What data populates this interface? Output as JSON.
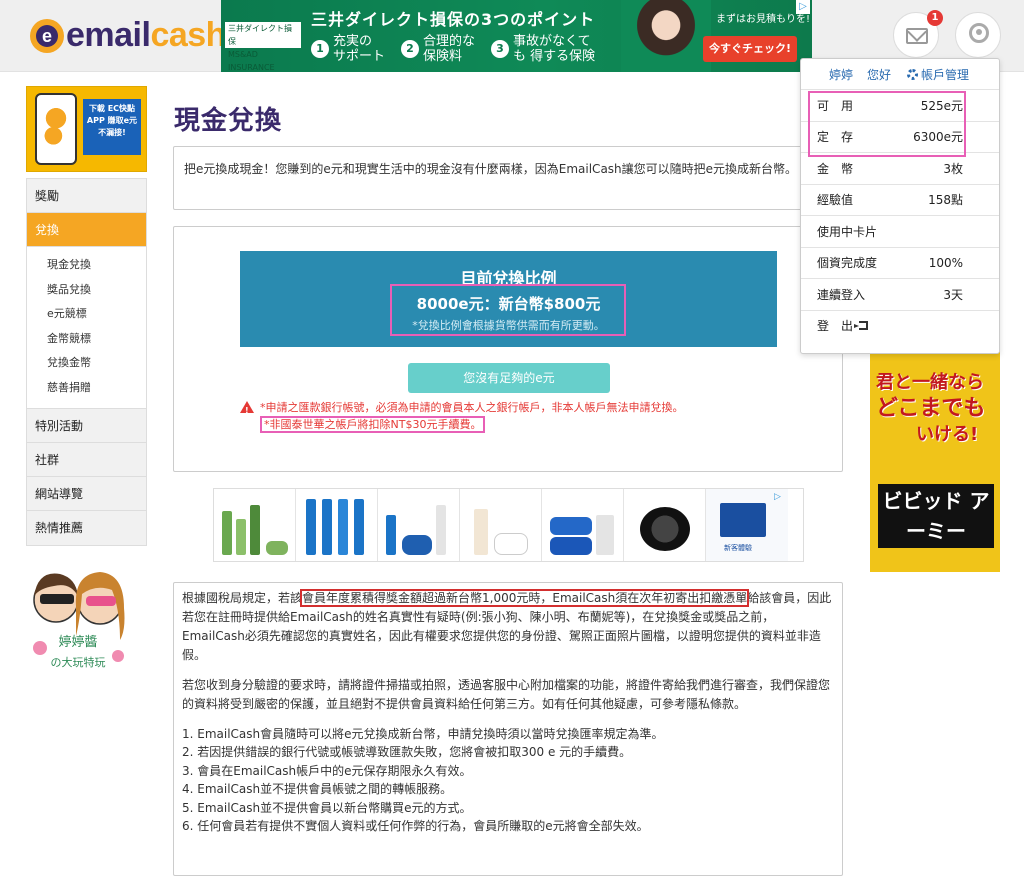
{
  "header": {
    "logo_e": "e",
    "logo_text_a": "email",
    "logo_text_b": "cash",
    "mail_badge": "1"
  },
  "top_ad": {
    "brand": "三井ダイレクト損保",
    "brand_sub": "MS&AD INSURANCE GROUP",
    "headline": "三井ダイレクト損保の3つのポイント",
    "points": [
      {
        "num": "1",
        "text": "充実の サポート"
      },
      {
        "num": "2",
        "text": "合理的な 保険料"
      },
      {
        "num": "3",
        "text": "事故がなくても 得する保険"
      }
    ],
    "small": "まずはお見積もりを!",
    "cta": "今すぐチェック!"
  },
  "sidebar": {
    "app_ad": "下載 EC快點APP 賺取e元 不漏接!",
    "items": [
      {
        "label": "獎勵"
      },
      {
        "label": "兌換"
      }
    ],
    "sub_items": [
      "現金兌換",
      "獎品兌換",
      "e元競標",
      "金幣競標",
      "兌換金幣",
      "慈善捐贈"
    ],
    "items_after": [
      {
        "label": "特別活動"
      },
      {
        "label": "社群"
      },
      {
        "label": "網站導覽"
      },
      {
        "label": "熱情推薦"
      }
    ],
    "mascot_text": "婷婷醬の大玩特玩"
  },
  "main": {
    "title": "現金兌換",
    "intro": "把e元換成現金！您賺到的e元和現實生活中的現金沒有什麼兩樣，因為EmailCash讓您可以隨時把e元換成新台幣。",
    "rate_title": "目前兌換比例",
    "rate_value": "8000e元：新台幣$800元",
    "rate_note": "*兌換比例會根據貨幣供需而有所更動。",
    "button": "您沒有足夠的e元",
    "warn_1": "*申請之匯款銀行帳號，必須為申請的會員本人之銀行帳戶，非本人帳戶無法申請兌換。",
    "warn_2": "*非國泰世華之帳戶將扣除NT$30元手續費。"
  },
  "rules": {
    "p1_a": "根據國稅局規定，若該",
    "p1_hl": "會員年度累積得獎金額超過新台幣1,000元時，EmailCash須在次年初寄出扣繳憑單",
    "p1_b": "給該會員，因此若您在註冊時提供給EmailCash的姓名真實性有疑時(例:張小狗、陳小明、布蘭妮等)，在兌換獎金或獎品之前，EmailCash必須先確認您的真實姓名，因此有權要求您提供您的身份證、駕照正面照片圖檔，以證明您提供的資料並非造假。",
    "p2": "若您收到身分驗證的要求時，請將證件掃描或拍照，透過客服中心附加檔案的功能，將證件寄給我們進行審查，我們保證您的資料將受到嚴密的保護，並且絕對不提供會員資料給任何第三方。如有任何其他疑慮，可參考隱私條款。",
    "list": [
      "1. EmailCash會員隨時可以將e元兌換成新台幣，申請兌換時須以當時兌換匯率規定為準。",
      "2. 若因提供錯誤的銀行代號或帳號導致匯款失敗，您將會被扣取300 e 元的手續費。",
      "3. 會員在EmailCash帳戶中的e元保存期限永久有效。",
      "4. EmailCash並不提供會員帳號之間的轉帳服務。",
      "5. EmailCash並不提供會員以新台幣購買e元的方式。",
      "6. 任何會員若有提供不實個人資料或任何作弊的行為，會員所賺取的e元將會全部失效。"
    ]
  },
  "product_ad": {
    "label": "新客體驗"
  },
  "side_ad": {
    "line1": "君と一緒なら",
    "line2": "どこまでも",
    "line3": "いける!",
    "logo": "ビビッド アーミー"
  },
  "dropdown": {
    "name": "婷婷",
    "greeting": "您好",
    "account": "帳戶管理",
    "rows": [
      {
        "label": "可　用",
        "value": "525e元"
      },
      {
        "label": "定　存",
        "value": "6300e元"
      },
      {
        "label": "金　幣",
        "value": "3枚"
      },
      {
        "label": "經驗值",
        "value": "158點"
      },
      {
        "label": "使用中卡片",
        "value": ""
      },
      {
        "label": "個資完成度",
        "value": "100%"
      },
      {
        "label": "連續登入",
        "value": "3天"
      },
      {
        "label": "登　出",
        "value": ""
      }
    ]
  },
  "colors": {
    "accent_orange": "#f5a623",
    "brand_purple": "#3a2a6b",
    "rate_blue": "#2a8bb0",
    "button_teal": "#67cfcb",
    "warn_red": "#e53935",
    "highlight_pink": "#e85fb6"
  }
}
